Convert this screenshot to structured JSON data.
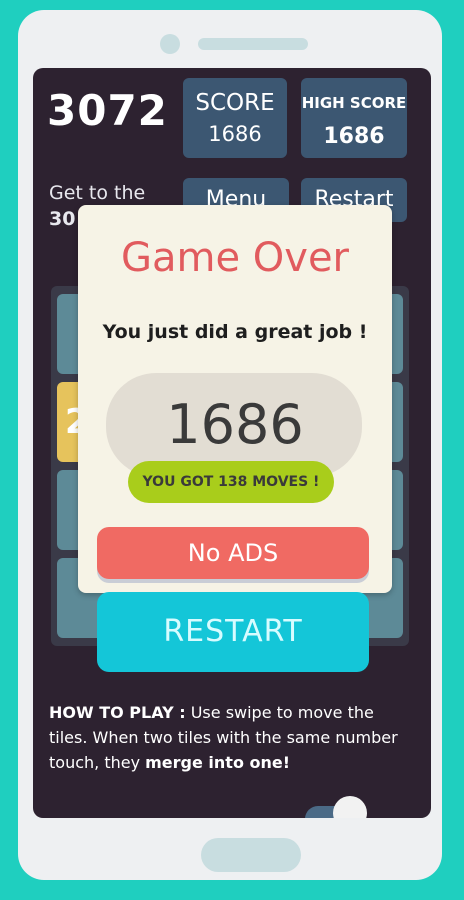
{
  "header": {
    "goal_number": "3072",
    "score_label": "SCORE",
    "score_value": "1686",
    "high_score_label": "HIGH SCORE",
    "high_score_value": "1686"
  },
  "goal": {
    "line1": "Get to the",
    "line2_number": "30"
  },
  "buttons": {
    "menu_label": "Menu",
    "restart_label": "Restart"
  },
  "board": {
    "visible_tile_text": "2"
  },
  "dialog": {
    "title": "Game Over",
    "subtitle": "You just did a great job !",
    "score": "1686",
    "moves": "YOU GOT 138 MOVES !",
    "no_ads_label": "No ADS",
    "restart_label": "RESTART"
  },
  "howto": {
    "title": "HOW TO PLAY :",
    "text_part1": " Use swipe to move the tiles. When two tiles with the same number touch, they ",
    "text_bold": "merge into one!"
  },
  "colors": {
    "background": "#1fcfbf",
    "screen": "#2d2230",
    "accent_red": "#e15b5e",
    "restart_cyan": "#14c6d8",
    "moves_green": "#a9cd1b"
  }
}
